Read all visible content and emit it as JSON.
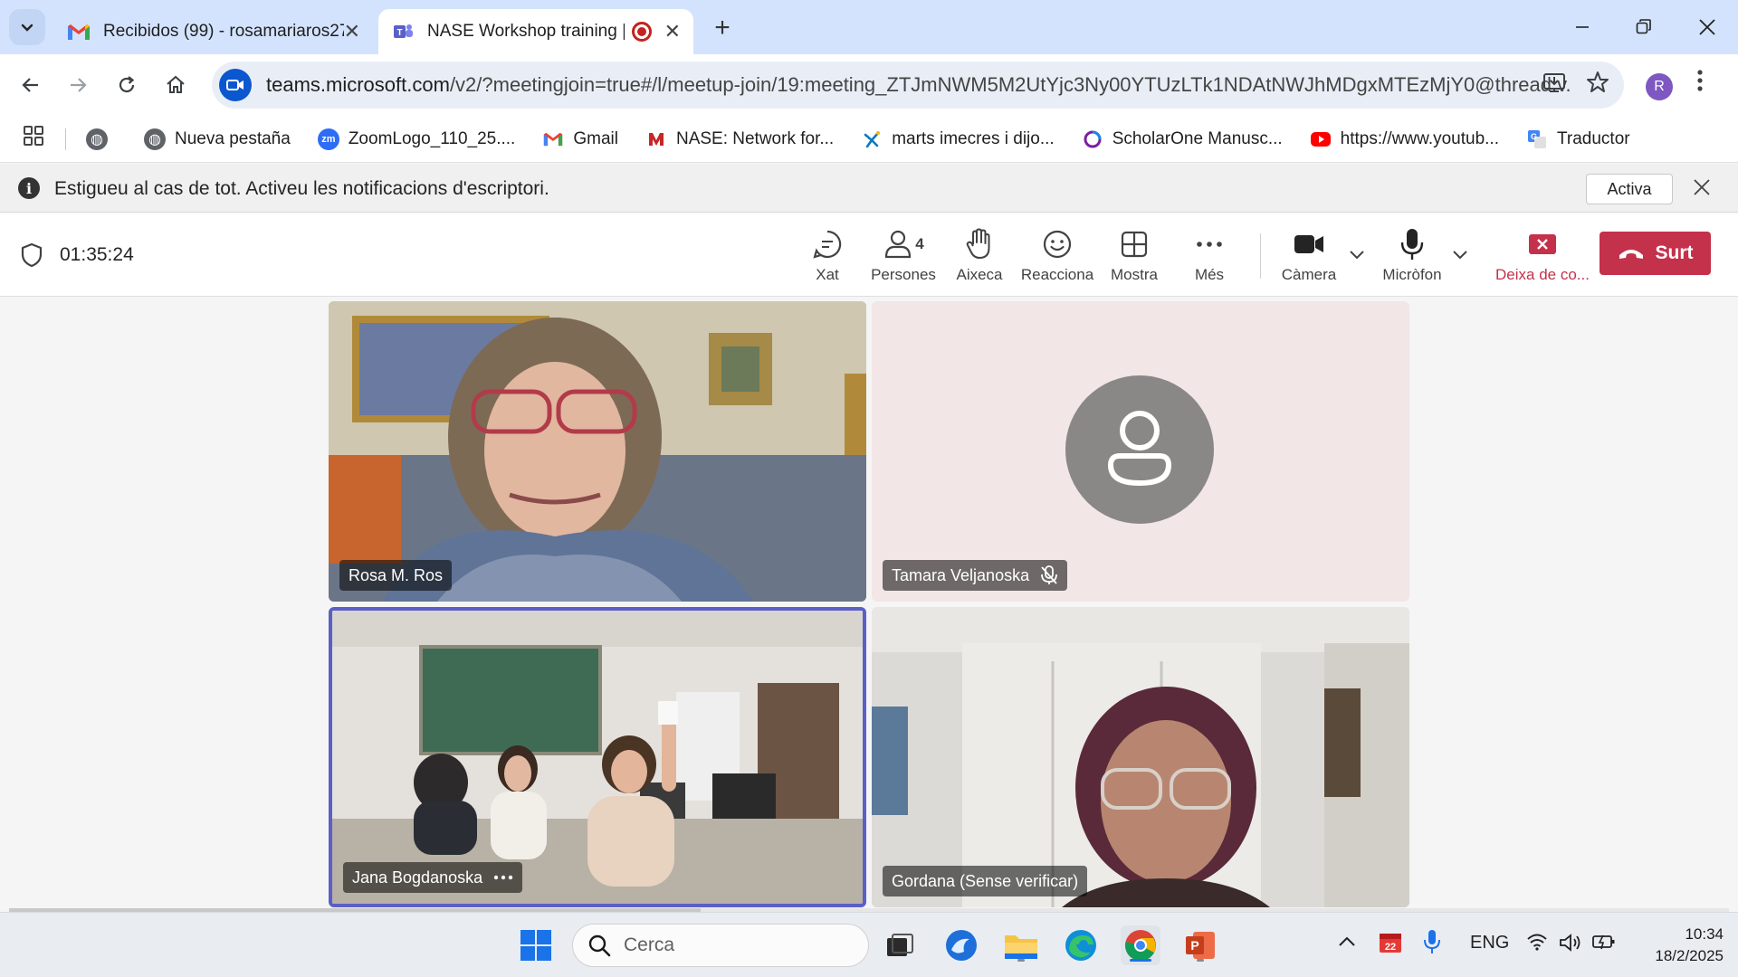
{
  "browser": {
    "tabs": [
      {
        "title": "Recibidos (99) - rosamariaros27",
        "icon": "gmail-icon"
      },
      {
        "title": "NASE Workshop training | M",
        "icon": "teams-icon",
        "recording": true
      }
    ],
    "url_host": "teams.microsoft.com",
    "url_rest": "/v2/?meetingjoin=true#/l/meetup-join/19:meeting_ZTJmNWM5M2UtYjc3Ny00YTUzLTk1NDAtNWJhMDgxMTEzMjY0@thread.v...",
    "profile_initial": "R",
    "bookmarks": [
      {
        "label": "",
        "icon": "globe-icon"
      },
      {
        "label": "Nueva pestaña",
        "icon": "globe-icon"
      },
      {
        "label": "ZoomLogo_110_25....",
        "icon": "zoom-icon"
      },
      {
        "label": "Gmail",
        "icon": "gmail-icon"
      },
      {
        "label": "NASE: Network for...",
        "icon": "nase-icon"
      },
      {
        "label": "marts imecres i dijo...",
        "icon": "caixabank-icon"
      },
      {
        "label": "ScholarOne Manusc...",
        "icon": "scholarone-icon"
      },
      {
        "label": "https://www.youtub...",
        "icon": "youtube-icon"
      },
      {
        "label": "Traductor",
        "icon": "translate-icon"
      }
    ]
  },
  "notification": {
    "message": "Estigueu al cas de tot. Activeu les notificacions d'escriptori.",
    "action": "Activa"
  },
  "meeting": {
    "timer": "01:35:24",
    "participants_count": "4",
    "controls": {
      "chat": "Xat",
      "people": "Persones",
      "raise": "Aixeca",
      "react": "Reacciona",
      "view": "Mostra",
      "more": "Més",
      "camera": "Càmera",
      "mic": "Micròfon",
      "stop_share": "Deixa de co...",
      "leave": "Surt"
    },
    "participants": [
      {
        "name": "Rosa M. Ros"
      },
      {
        "name": "Tamara Veljanoska",
        "muted": true
      },
      {
        "name": "Jana Bogdanoska",
        "active_speaker": true
      },
      {
        "name": "Gordana (Sense verificar)"
      }
    ]
  },
  "taskbar": {
    "search_placeholder": "Cerca",
    "language": "ENG",
    "time": "10:34",
    "date": "18/2/2025",
    "calendar_badge": "22"
  },
  "colors": {
    "teams_purple": "#5b5fc7",
    "leave_red": "#c4314b",
    "tabstrip": "#d3e3fd"
  }
}
